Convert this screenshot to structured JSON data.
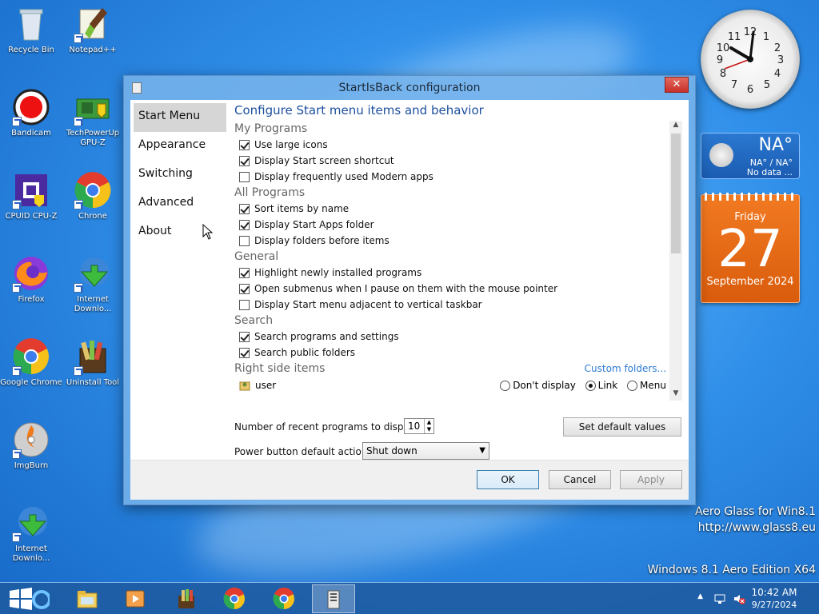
{
  "desktop": {
    "icons": [
      {
        "label": "Recycle Bin",
        "icon": "recycle-bin-icon"
      },
      {
        "label": "Notepad++",
        "icon": "notepadpp-icon"
      },
      {
        "label": "Bandicam",
        "icon": "bandicam-icon"
      },
      {
        "label": "TechPowerUp GPU-Z",
        "icon": "gpuz-icon"
      },
      {
        "label": "CPUID CPU-Z",
        "icon": "cpuz-icon"
      },
      {
        "label": "Chrone",
        "icon": "chrome-icon"
      },
      {
        "label": "Firefox",
        "icon": "firefox-icon"
      },
      {
        "label": "Internet Downlo...",
        "icon": "idm-icon"
      },
      {
        "label": "Google Chrome",
        "icon": "chrome-icon"
      },
      {
        "label": "Uninstall Tool",
        "icon": "uninstall-tool-icon"
      },
      {
        "label": "ImgBurn",
        "icon": "imgburn-icon"
      },
      {
        "label": "Internet Downlo...",
        "icon": "idm-icon"
      }
    ],
    "watermark": {
      "line1": "Aero Glass for Win8.1",
      "line2": "http://www.glass8.eu",
      "edition": "Windows 8.1 Aero Edition X64"
    }
  },
  "gadgets": {
    "weather": {
      "temp": "NA°",
      "range": "NA° / NA°",
      "status": "No data ..."
    },
    "calendar": {
      "weekday": "Friday",
      "day": "27",
      "month_year": "September 2024"
    }
  },
  "window": {
    "title": "StartIsBack configuration",
    "close_glyph": "✕",
    "nav": [
      "Start Menu",
      "Appearance",
      "Switching",
      "Advanced",
      "About"
    ],
    "heading": "Configure Start menu items and behavior",
    "sections": {
      "my_programs": {
        "title": "My Programs",
        "options": [
          {
            "label": "Use large icons",
            "checked": true
          },
          {
            "label": "Display Start screen shortcut",
            "checked": true
          },
          {
            "label": "Display frequently used Modern apps",
            "checked": false
          }
        ]
      },
      "all_programs": {
        "title": "All Programs",
        "options": [
          {
            "label": "Sort items by name",
            "checked": true
          },
          {
            "label": "Display Start Apps folder",
            "checked": true
          },
          {
            "label": "Display folders before items",
            "checked": false
          }
        ]
      },
      "general": {
        "title": "General",
        "options": [
          {
            "label": "Highlight newly installed programs",
            "checked": true
          },
          {
            "label": "Open submenus when I pause on them with the mouse pointer",
            "checked": true
          },
          {
            "label": "Display Start menu adjacent to vertical taskbar",
            "checked": false
          }
        ]
      },
      "search": {
        "title": "Search",
        "options": [
          {
            "label": "Search programs and settings",
            "checked": true
          },
          {
            "label": "Search public folders",
            "checked": true
          }
        ]
      },
      "right_side": {
        "title": "Right side items",
        "custom_folders": "Custom folders...",
        "item_label": "user",
        "radios": [
          {
            "label": "Don't display",
            "selected": false
          },
          {
            "label": "Link",
            "selected": true
          },
          {
            "label": "Menu",
            "selected": false
          }
        ]
      }
    },
    "recent_label": "Number of recent programs to display:",
    "recent_value": "10",
    "set_default": "Set default values",
    "power_label": "Power button default action:",
    "power_value": "Shut down",
    "ok": "OK",
    "cancel": "Cancel",
    "apply": "Apply"
  },
  "taskbar": {
    "time": "10:42 AM",
    "date": "9/27/2024"
  }
}
